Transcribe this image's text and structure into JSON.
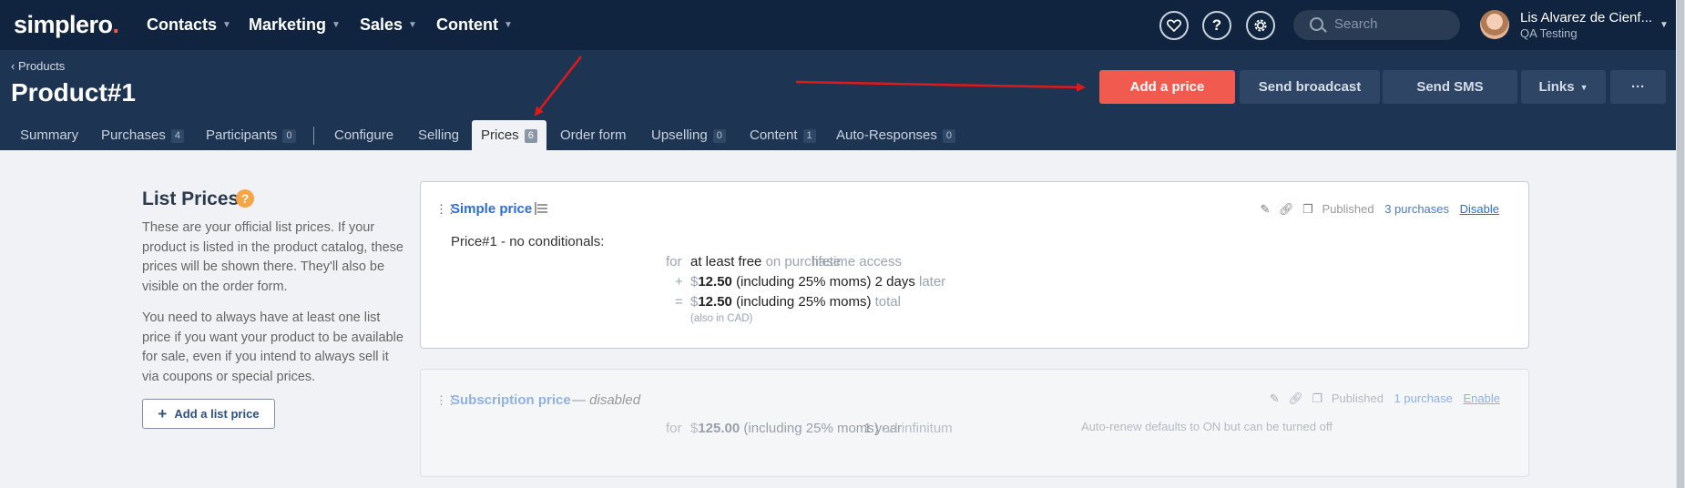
{
  "app": {
    "logo_text": "simplero",
    "logo_dot": ".",
    "nav": [
      "Contacts",
      "Marketing",
      "Sales",
      "Content"
    ],
    "help_glyph": "?",
    "search_placeholder": "Search",
    "user": {
      "name": "Lis Alvarez de Cienf...",
      "org": "QA Testing"
    }
  },
  "page": {
    "breadcrumb": "‹ Products",
    "title": "Product#1",
    "buttons": {
      "add_price": "Add a price",
      "send_broadcast": "Send broadcast",
      "send_sms": "Send SMS",
      "links": "Links",
      "more": "···"
    },
    "tabs": [
      {
        "label": "Summary",
        "badge": ""
      },
      {
        "label": "Purchases",
        "badge": "4"
      },
      {
        "label": "Participants",
        "badge": "0"
      },
      {
        "label": "Configure",
        "badge": ""
      },
      {
        "label": "Selling",
        "badge": ""
      },
      {
        "label": "Prices",
        "badge": "6"
      },
      {
        "label": "Order form",
        "badge": ""
      },
      {
        "label": "Upselling",
        "badge": "0"
      },
      {
        "label": "Content",
        "badge": "1"
      },
      {
        "label": "Auto-Responses",
        "badge": "0"
      }
    ],
    "active_tab": "Prices"
  },
  "list_prices": {
    "title": "List Prices",
    "help_glyph": "?",
    "p1": "These are your official list prices. If your product is listed in the product catalog, these prices will be shown there. They'll also be visible on the order form.",
    "p2": "You need to always have at least one list price if you want your product to be available for sale, even if you intend to always sell it via coupons or special prices.",
    "add_button": "Add a list price"
  },
  "prices": [
    {
      "title": "Simple price",
      "status": "Published",
      "purchases": "3 purchases",
      "toggle": "Disable",
      "name": "Price#1 - no conditionals:",
      "access": "lifetime access",
      "for": "for",
      "line1_amount": "at least free",
      "line1_suffix": "on purchase",
      "plus": "+",
      "equals": "=",
      "currency": "$",
      "line2_amount": "12.50",
      "line2_detail": "(including 25% moms) 2 days",
      "line2_suffix": "later",
      "line3_amount": "12.50",
      "line3_detail": "(including 25% moms)",
      "line3_suffix": "total",
      "also": "(also in CAD)"
    },
    {
      "title": "Subscription price",
      "note": "— disabled",
      "status": "Published",
      "purchases": "1 purchase",
      "toggle": "Enable",
      "period": "1 year",
      "for": "for",
      "currency": "$",
      "amount": "125.00",
      "detail": "(including 25% moms)",
      "suffix": "ad infinitum",
      "auto_renew": "Auto-renew defaults to ON but can be turned off"
    }
  ],
  "colors": {
    "topbar": "#10243f",
    "subbar": "#1e3453",
    "accent": "#f05a4f",
    "link": "#2d6cd9",
    "annotation": "#e0191a"
  }
}
